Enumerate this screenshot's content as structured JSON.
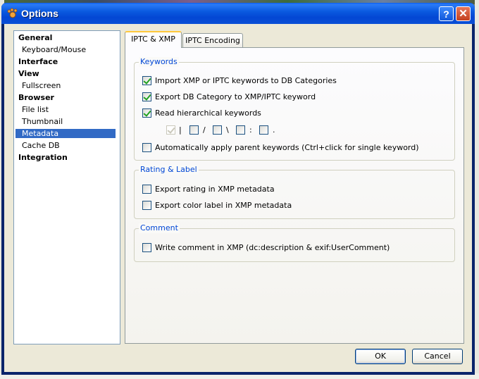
{
  "window": {
    "title": "Options"
  },
  "nav": {
    "items": [
      {
        "label": "General",
        "level": "top"
      },
      {
        "label": "Keyboard/Mouse",
        "level": "sub"
      },
      {
        "label": "Interface",
        "level": "top"
      },
      {
        "label": "View",
        "level": "top"
      },
      {
        "label": "Fullscreen",
        "level": "sub"
      },
      {
        "label": "Browser",
        "level": "top"
      },
      {
        "label": "File list",
        "level": "sub"
      },
      {
        "label": "Thumbnail",
        "level": "sub"
      },
      {
        "label": "Metadata",
        "level": "sub",
        "selected": true
      },
      {
        "label": "Cache DB",
        "level": "sub"
      },
      {
        "label": "Integration",
        "level": "top"
      }
    ]
  },
  "tabs": [
    {
      "label": "IPTC & XMP",
      "active": true
    },
    {
      "label": "IPTC Encoding",
      "active": false
    }
  ],
  "keywords": {
    "title": "Keywords",
    "import": {
      "label": "Import XMP or IPTC keywords to DB Categories",
      "checked": true
    },
    "export": {
      "label": "Export DB Category to XMP/IPTC keyword",
      "checked": true
    },
    "hier": {
      "label": "Read hierarchical keywords",
      "checked": true
    },
    "separators": [
      "|",
      "/",
      "\\",
      ":",
      "."
    ],
    "separators_checked": [
      true,
      false,
      false,
      false,
      false
    ],
    "auto": {
      "label": "Automatically apply parent keywords (Ctrl+click for single keyword)",
      "checked": false
    }
  },
  "rating": {
    "title": "Rating & Label",
    "rating": {
      "label": "Export rating in XMP metadata",
      "checked": false
    },
    "color": {
      "label": "Export color label in XMP metadata",
      "checked": false
    }
  },
  "comment": {
    "title": "Comment",
    "write": {
      "label": "Write comment in XMP (dc:description & exif:UserComment)",
      "checked": false
    }
  },
  "buttons": {
    "ok": "OK",
    "cancel": "Cancel"
  },
  "colors": {
    "accent": "#316ac5",
    "group_title": "#0046d5",
    "titlebar": "#0346d3"
  }
}
